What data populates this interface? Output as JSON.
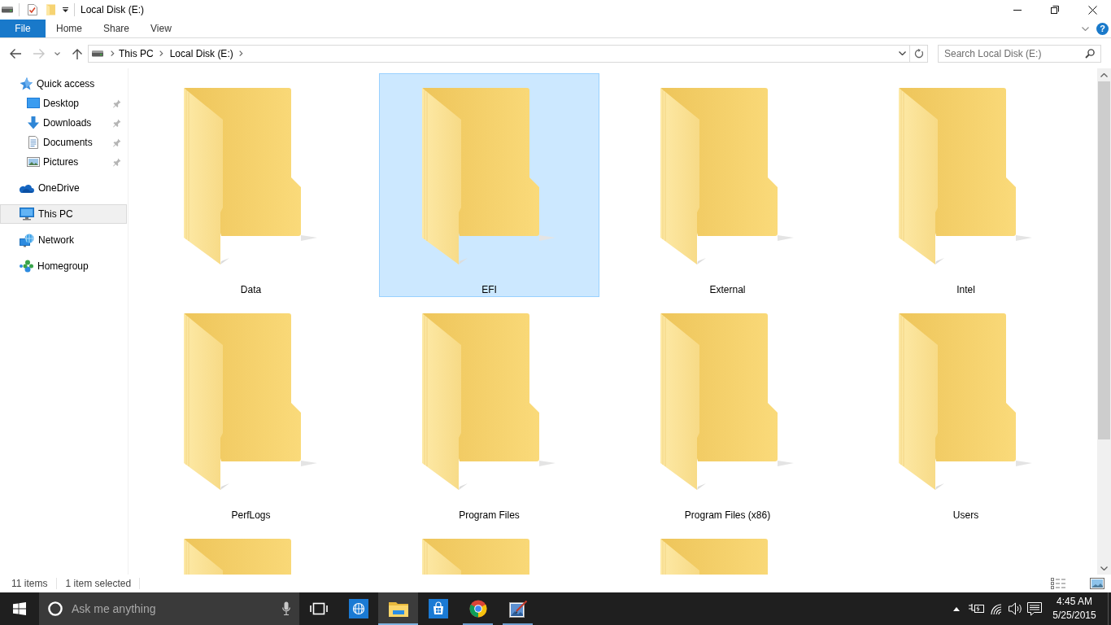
{
  "window": {
    "title": "Local Disk (E:)"
  },
  "ribbon": {
    "tabs": [
      {
        "label": "File",
        "kind": "menu",
        "selected": false
      },
      {
        "label": "Home",
        "kind": "tab",
        "selected": false
      },
      {
        "label": "Share",
        "kind": "tab",
        "selected": false
      },
      {
        "label": "View",
        "kind": "tab",
        "selected": false
      }
    ],
    "help": "?"
  },
  "address_bar": {
    "path": [
      "This PC",
      "Local Disk (E:)"
    ]
  },
  "search": {
    "placeholder": "Search Local Disk (E:)"
  },
  "sidebar": {
    "items": [
      {
        "label": "Quick access",
        "kind": "quick-access",
        "selected": false,
        "children": [
          {
            "label": "Desktop",
            "kind": "desktop",
            "pinned": true,
            "selected": false
          },
          {
            "label": "Downloads",
            "kind": "downloads",
            "pinned": true,
            "selected": false
          },
          {
            "label": "Documents",
            "kind": "documents",
            "pinned": true,
            "selected": false
          },
          {
            "label": "Pictures",
            "kind": "pictures",
            "pinned": true,
            "selected": false
          }
        ]
      },
      {
        "label": "OneDrive",
        "kind": "cloud",
        "selected": false
      },
      {
        "label": "This PC",
        "kind": "pc",
        "selected": true
      },
      {
        "label": "Network",
        "kind": "network",
        "selected": false
      },
      {
        "label": "Homegroup",
        "kind": "homegroup",
        "selected": false
      }
    ]
  },
  "folders": [
    {
      "name": "Data",
      "selected": false
    },
    {
      "name": "EFI",
      "selected": true
    },
    {
      "name": "External",
      "selected": false
    },
    {
      "name": "Intel",
      "selected": false
    },
    {
      "name": "PerfLogs",
      "selected": false
    },
    {
      "name": "Program Files",
      "selected": false
    },
    {
      "name": "Program Files (x86)",
      "selected": false
    },
    {
      "name": "Users",
      "selected": false
    },
    {
      "selected": false
    },
    {
      "selected": false
    },
    {
      "selected": false
    }
  ],
  "status_bar": {
    "item_count": "11 items",
    "selection": "1 item selected"
  },
  "taskbar": {
    "search_placeholder": "Ask me anything",
    "apps": [
      {
        "kind": "globe",
        "running": false,
        "selected": false
      },
      {
        "kind": "explorer",
        "running": true,
        "selected": true
      },
      {
        "kind": "store",
        "running": false,
        "selected": false
      },
      {
        "kind": "chrome",
        "running": true,
        "selected": false
      },
      {
        "kind": "paint",
        "running": true,
        "selected": false
      }
    ],
    "clock": {
      "time": "4:45 AM",
      "date": "5/25/2015"
    }
  }
}
